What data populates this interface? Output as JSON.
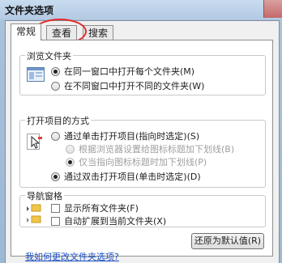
{
  "window": {
    "title": "文件夹选项"
  },
  "tabs": [
    "常规",
    "查看",
    "搜索"
  ],
  "browse_group": {
    "label": "浏览文件夹",
    "options": [
      {
        "label": "在同一窗口中打开每个文件夹(M)",
        "checked": true
      },
      {
        "label": "在不同窗口中打开不同的文件夹(W)",
        "checked": false
      }
    ]
  },
  "open_group": {
    "label": "打开项目的方式",
    "options": [
      {
        "label": "通过单击打开项目(指向时选定)(S)",
        "checked": false,
        "disabled": false
      },
      {
        "label": "根据浏览器设置给图标标题加下划线(B)",
        "checked": false,
        "disabled": true
      },
      {
        "label": "仅当指向图标标题时加下划线(P)",
        "checked": true,
        "disabled": true
      },
      {
        "label": "通过双击打开项目(单击时选定)(D)",
        "checked": true,
        "disabled": false
      }
    ]
  },
  "nav_group": {
    "label": "导航窗格",
    "checks": [
      {
        "label": "显示所有文件夹(F)",
        "checked": false
      },
      {
        "label": "自动扩展到当前文件夹(X)",
        "checked": false
      }
    ]
  },
  "restore_button": "还原为默认值(R)",
  "help_link": "我如何更改文件夹选项?",
  "colors": {
    "accent_ring": "#e22b2b",
    "link": "#1a4fc6"
  }
}
